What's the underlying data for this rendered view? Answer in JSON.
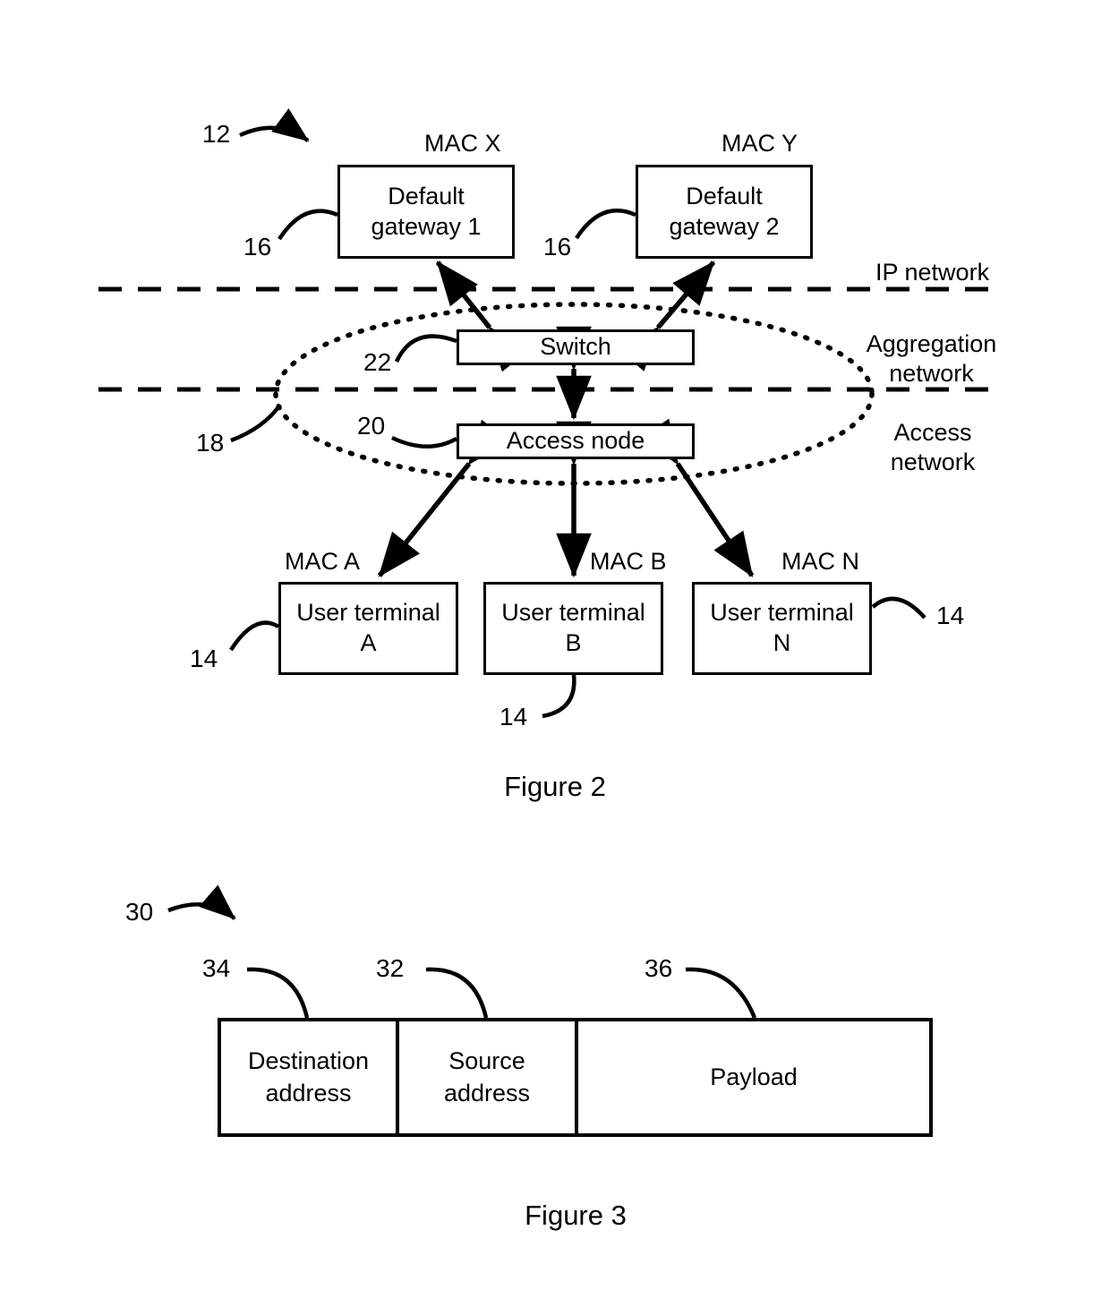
{
  "figure2": {
    "caption": "Figure 2",
    "ref_system": "12",
    "nodes": {
      "gateway1": {
        "label": "Default\ngateway 1",
        "mac": "MAC X",
        "ref": "16"
      },
      "gateway2": {
        "label": "Default\ngateway 2",
        "mac": "MAC Y",
        "ref": "16"
      },
      "switch": {
        "label": "Switch",
        "ref": "22"
      },
      "access_node": {
        "label": "Access node",
        "ref": "20"
      },
      "terminal_a": {
        "label": "User terminal\nA",
        "mac": "MAC A",
        "ref": "14"
      },
      "terminal_b": {
        "label": "User terminal\nB",
        "mac": "MAC B",
        "ref": "14"
      },
      "terminal_n": {
        "label": "User terminal\nN",
        "mac": "MAC N",
        "ref": "14"
      }
    },
    "ellipse_ref": "18",
    "zones": {
      "ip": "IP network",
      "aggregation": "Aggregation\nnetwork",
      "access": "Access\nnetwork"
    }
  },
  "figure3": {
    "caption": "Figure 3",
    "ref_frame": "30",
    "fields": [
      {
        "label": "Destination\naddress",
        "ref": "34"
      },
      {
        "label": "Source\naddress",
        "ref": "32"
      },
      {
        "label": "Payload",
        "ref": "36"
      }
    ]
  }
}
